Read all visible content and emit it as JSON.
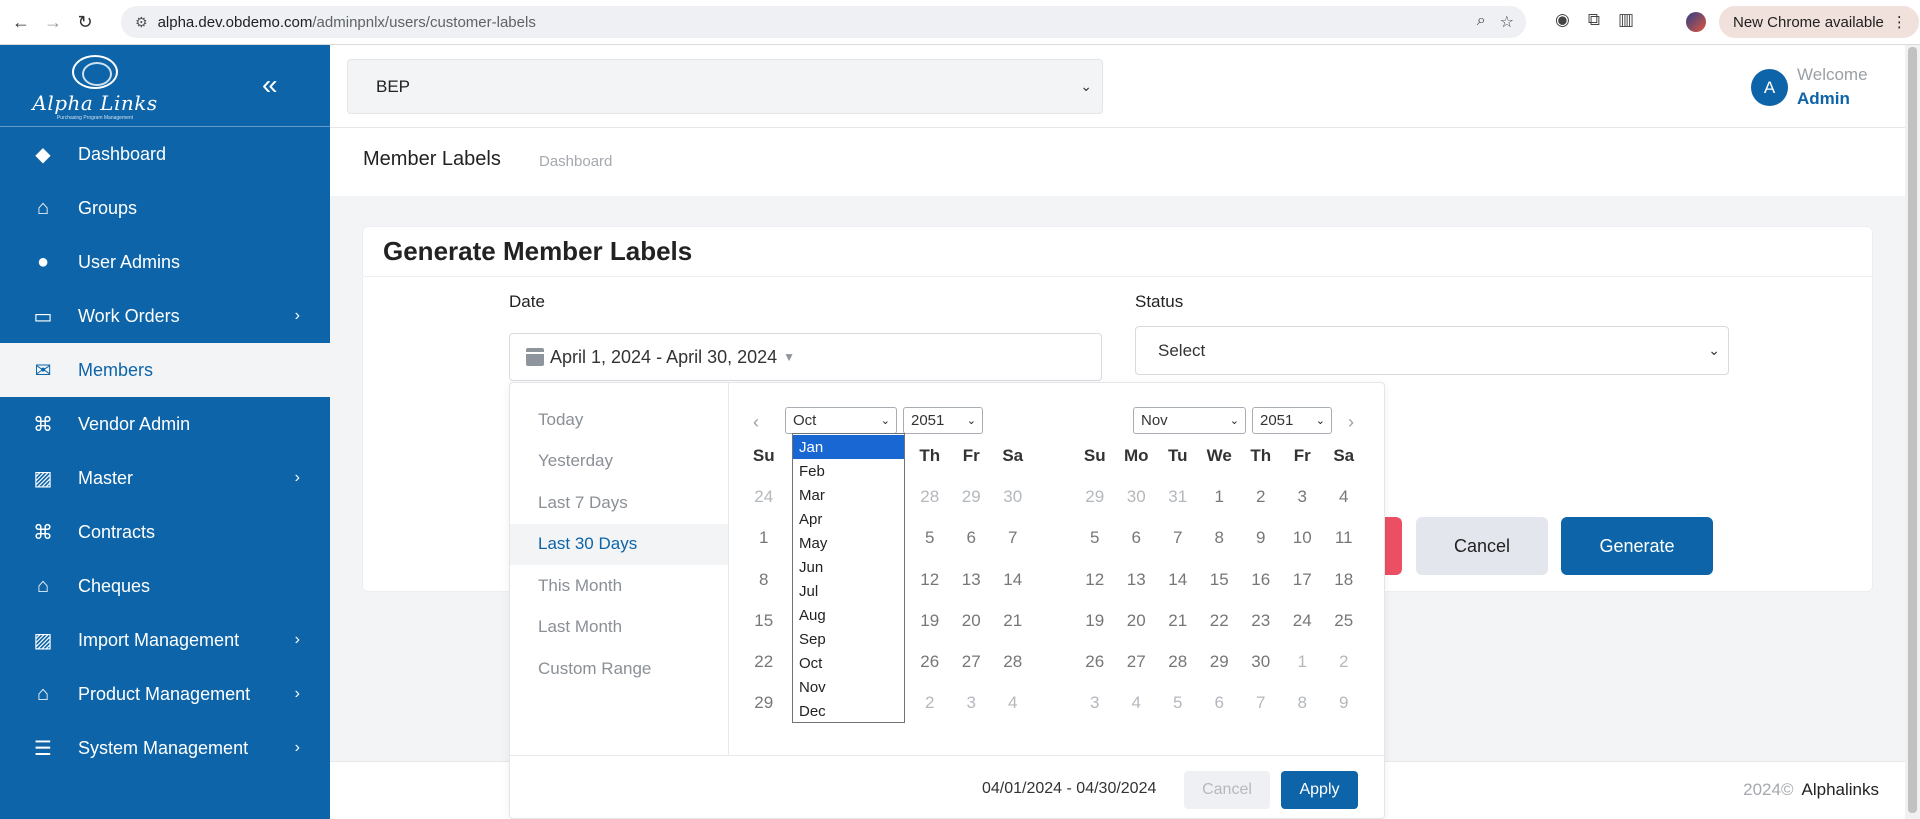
{
  "browser": {
    "url_host": "alpha.dev.obdemo.com",
    "url_path": "/adminpnlx/users/customer-labels",
    "update_label": "New Chrome available"
  },
  "sidebar": {
    "brand_name": "Alpha Links",
    "brand_tagline": "Purchasing Program Management",
    "items": [
      {
        "label": "Dashboard",
        "icon": "diamond-icon",
        "has_children": false,
        "active": false
      },
      {
        "label": "Groups",
        "icon": "home-icon",
        "has_children": false,
        "active": false
      },
      {
        "label": "User Admins",
        "icon": "user-icon",
        "has_children": false,
        "active": false
      },
      {
        "label": "Work Orders",
        "icon": "card-icon",
        "has_children": true,
        "active": false
      },
      {
        "label": "Members",
        "icon": "envelope-icon",
        "has_children": false,
        "active": true
      },
      {
        "label": "Vendor Admin",
        "icon": "command-icon",
        "has_children": false,
        "active": false
      },
      {
        "label": "Master",
        "icon": "image-icon",
        "has_children": true,
        "active": false
      },
      {
        "label": "Contracts",
        "icon": "command-icon",
        "has_children": false,
        "active": false
      },
      {
        "label": "Cheques",
        "icon": "home-icon",
        "has_children": false,
        "active": false
      },
      {
        "label": "Import Management",
        "icon": "image-icon",
        "has_children": true,
        "active": false
      },
      {
        "label": "Product Management",
        "icon": "home-icon",
        "has_children": true,
        "active": false
      },
      {
        "label": "System Management",
        "icon": "server-icon",
        "has_children": true,
        "active": false
      }
    ]
  },
  "topbar": {
    "company_selected": "BEP",
    "avatar_letter": "A",
    "welcome_text": "Welcome",
    "user_name": "Admin"
  },
  "page": {
    "title": "Member Labels",
    "breadcrumb": "Dashboard"
  },
  "form": {
    "heading": "Generate Member Labels",
    "date_label": "Date",
    "date_value": "April 1, 2024 - April 30, 2024",
    "status_label": "Status",
    "status_value": "Select",
    "cancel_label": "Cancel",
    "generate_label": "Generate"
  },
  "datepicker": {
    "ranges": [
      "Today",
      "Yesterday",
      "Last 7 Days",
      "Last 30 Days",
      "This Month",
      "Last Month",
      "Custom Range"
    ],
    "active_range": "Last 30 Days",
    "weekdays": [
      "Su",
      "Mo",
      "Tu",
      "We",
      "Th",
      "Fr",
      "Sa"
    ],
    "left": {
      "month": "Oct",
      "year": "2051",
      "rows": [
        [
          "24",
          "",
          "",
          "",
          "28",
          "29",
          "30"
        ],
        [
          "1",
          "",
          "",
          "",
          "5",
          "6",
          "7"
        ],
        [
          "8",
          "",
          "",
          "",
          "12",
          "13",
          "14"
        ],
        [
          "15",
          "",
          "",
          "",
          "19",
          "20",
          "21"
        ],
        [
          "22",
          "",
          "",
          "",
          "26",
          "27",
          "28"
        ],
        [
          "29",
          "",
          "",
          "",
          "2",
          "3",
          "4"
        ]
      ],
      "off_cells": [
        [
          0,
          0
        ],
        [
          0,
          4
        ],
        [
          0,
          5
        ],
        [
          0,
          6
        ],
        [
          5,
          4
        ],
        [
          5,
          5
        ],
        [
          5,
          6
        ]
      ]
    },
    "right": {
      "month": "Nov",
      "year": "2051",
      "rows": [
        [
          "29",
          "30",
          "31",
          "1",
          "2",
          "3",
          "4"
        ],
        [
          "5",
          "6",
          "7",
          "8",
          "9",
          "10",
          "11"
        ],
        [
          "12",
          "13",
          "14",
          "15",
          "16",
          "17",
          "18"
        ],
        [
          "19",
          "20",
          "21",
          "22",
          "23",
          "24",
          "25"
        ],
        [
          "26",
          "27",
          "28",
          "29",
          "30",
          "1",
          "2"
        ],
        [
          "3",
          "4",
          "5",
          "6",
          "7",
          "8",
          "9"
        ]
      ],
      "off_cells": [
        [
          0,
          0
        ],
        [
          0,
          1
        ],
        [
          0,
          2
        ],
        [
          4,
          5
        ],
        [
          4,
          6
        ],
        [
          5,
          0
        ],
        [
          5,
          1
        ],
        [
          5,
          2
        ],
        [
          5,
          3
        ],
        [
          5,
          4
        ],
        [
          5,
          5
        ],
        [
          5,
          6
        ]
      ]
    },
    "month_options": [
      "Jan",
      "Feb",
      "Mar",
      "Apr",
      "May",
      "Jun",
      "Jul",
      "Aug",
      "Sep",
      "Oct",
      "Nov",
      "Dec"
    ],
    "highlighted_option": "Jan",
    "selected_range_text": "04/01/2024 - 04/30/2024",
    "cancel_label": "Cancel",
    "apply_label": "Apply"
  },
  "footer": {
    "year": "2024©",
    "company": "Alphalinks"
  },
  "colors": {
    "brand": "#0d64a8",
    "danger": "#ec4f63",
    "highlight": "#1967d2"
  }
}
